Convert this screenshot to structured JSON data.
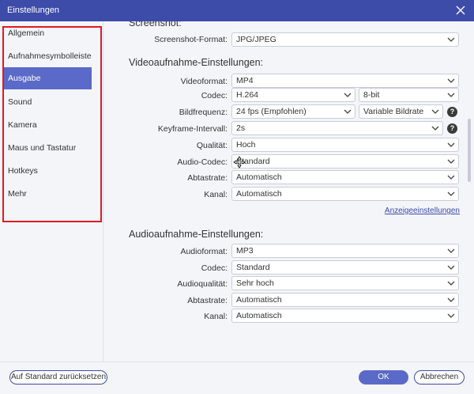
{
  "window": {
    "title": "Einstellungen"
  },
  "sidebar": {
    "items": [
      {
        "label": "Allgemein",
        "active": false
      },
      {
        "label": "Aufnahmesymbolleiste",
        "active": false
      },
      {
        "label": "Ausgabe",
        "active": true
      },
      {
        "label": "Sound",
        "active": false
      },
      {
        "label": "Kamera",
        "active": false
      },
      {
        "label": "Maus und Tastatur",
        "active": false
      },
      {
        "label": "Hotkeys",
        "active": false
      },
      {
        "label": "Mehr",
        "active": false
      }
    ]
  },
  "screenshot": {
    "section_title": "Screenshot:",
    "format_label": "Screenshot-Format:",
    "format_value": "JPG/JPEG"
  },
  "video": {
    "section_title": "Videoaufnahme-Einstellungen:",
    "format_label": "Videoformat:",
    "format_value": "MP4",
    "codec_label": "Codec:",
    "codec_value": "H.264",
    "bitdepth_value": "8-bit",
    "framerate_label": "Bildfrequenz:",
    "framerate_value": "24 fps (Empfohlen)",
    "bitrate_value": "Variable Bildrate",
    "keyframe_label": "Keyframe-Intervall:",
    "keyframe_value": "2s",
    "quality_label": "Qualität:",
    "quality_value": "Hoch",
    "audio_codec_label": "Audio-Codec:",
    "audio_codec_value": "Standard",
    "samplerate_label": "Abtastrate:",
    "samplerate_value": "Automatisch",
    "channel_label": "Kanal:",
    "channel_value": "Automatisch",
    "display_settings_link": "Anzeigeeinstellungen"
  },
  "audio": {
    "section_title": "Audioaufnahme-Einstellungen:",
    "format_label": "Audioformat:",
    "format_value": "MP3",
    "codec_label": "Codec:",
    "codec_value": "Standard",
    "quality_label": "Audioqualität:",
    "quality_value": "Sehr hoch",
    "samplerate_label": "Abtastrate:",
    "samplerate_value": "Automatisch",
    "channel_label": "Kanal:",
    "channel_value": "Automatisch"
  },
  "footer": {
    "reset_label": "Auf Standard zurücksetzen",
    "ok_label": "OK",
    "cancel_label": "Abbrechen"
  },
  "help_glyph": "?",
  "colors": {
    "titlebar": "#3d4ba9",
    "accent": "#5b6ac8",
    "highlight_box": "#e01a22"
  }
}
